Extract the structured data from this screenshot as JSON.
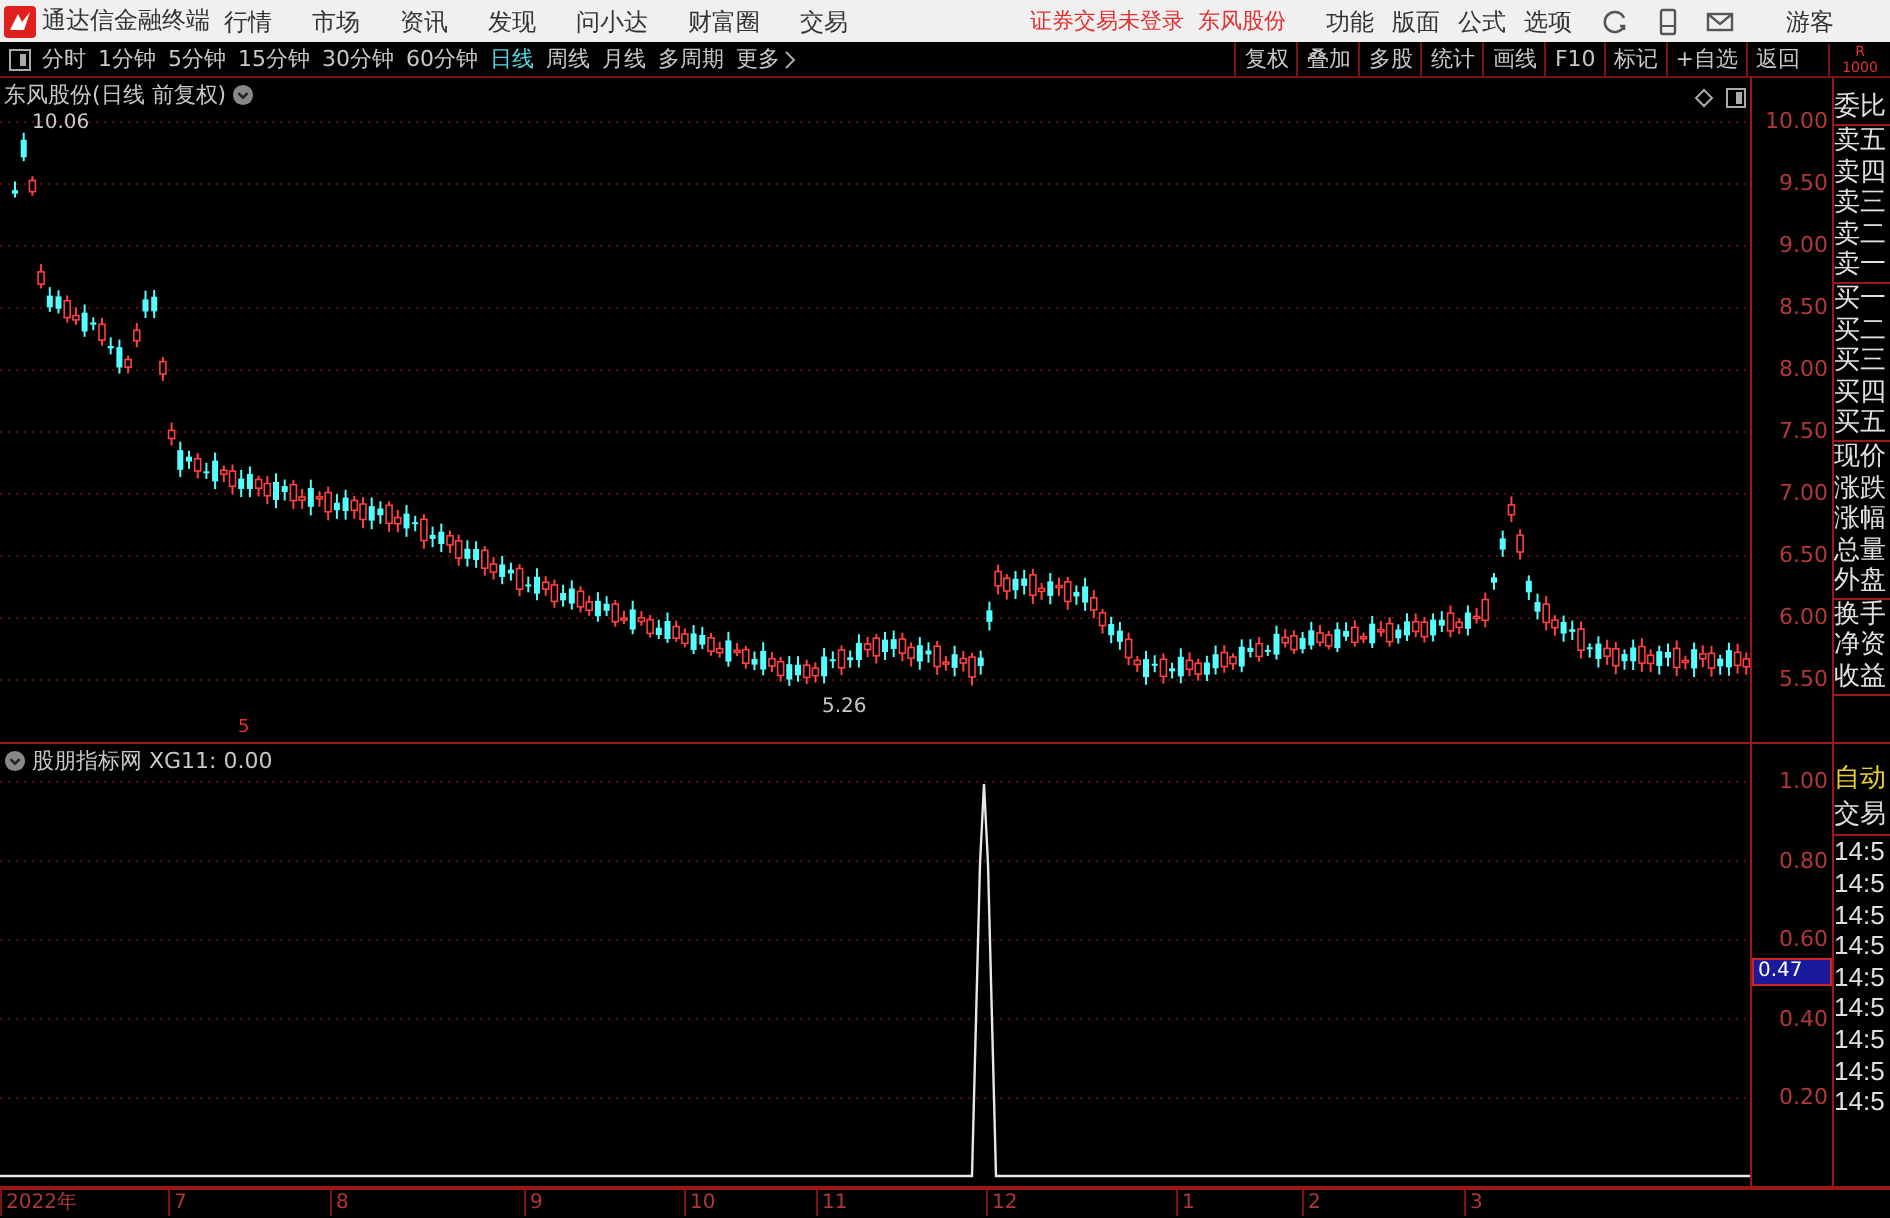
{
  "menubar": {
    "app_title": "通达信金融终端",
    "menus": [
      "行情",
      "市场",
      "资讯",
      "发现",
      "问小达",
      "财富圈",
      "交易"
    ],
    "status": [
      "证券交易未登录",
      "东风股份"
    ],
    "right_menus": [
      "功能",
      "版面",
      "公式",
      "选项"
    ],
    "user": "游客"
  },
  "toolbar": {
    "periods": [
      {
        "label": "分时",
        "selected": false
      },
      {
        "label": "1分钟",
        "selected": false
      },
      {
        "label": "5分钟",
        "selected": false
      },
      {
        "label": "15分钟",
        "selected": false
      },
      {
        "label": "30分钟",
        "selected": false
      },
      {
        "label": "60分钟",
        "selected": false
      },
      {
        "label": "日线",
        "selected": true
      },
      {
        "label": "周线",
        "selected": false
      },
      {
        "label": "月线",
        "selected": false
      },
      {
        "label": "多周期",
        "selected": false
      },
      {
        "label": "更多",
        "selected": false
      }
    ],
    "buttons": [
      "复权",
      "叠加",
      "多股",
      "统计",
      "画线",
      "F10",
      "标记",
      "+自选",
      "返回"
    ],
    "corner": [
      "R",
      "1000"
    ]
  },
  "chart": {
    "title": "东风股份(日线 前复权)",
    "high_label": "10.06",
    "low_label": "5.26",
    "marker": "5",
    "price_ticks": [
      "10.00",
      "9.50",
      "9.00",
      "8.50",
      "8.00",
      "7.50",
      "7.00",
      "6.50",
      "6.00",
      "5.50"
    ]
  },
  "indicator": {
    "title": "股朋指标网 XG11: 0.00",
    "ticks": [
      "1.00",
      "0.80",
      "0.60",
      "0.40",
      "0.20"
    ],
    "cursor_value": "0.47"
  },
  "time_axis": [
    "2022年",
    "7",
    "8",
    "9",
    "10",
    "11",
    "12",
    "1",
    "2",
    "3"
  ],
  "quote_panel": {
    "groups": [
      [
        "委比"
      ],
      [
        "卖五",
        "卖四",
        "卖三",
        "卖二",
        "卖一"
      ],
      [
        "买一",
        "买二",
        "买三",
        "买四",
        "买五"
      ],
      [
        "现价",
        "涨跌",
        "涨幅",
        "总量",
        "外盘"
      ],
      [
        "换手",
        "净资",
        "收益"
      ]
    ],
    "mode": "自动",
    "trade_label": "交易",
    "trades": [
      "14:5",
      "14:5",
      "14:5",
      "14:5",
      "14:5",
      "14:5",
      "14:5",
      "14:5",
      "14:5"
    ]
  }
}
